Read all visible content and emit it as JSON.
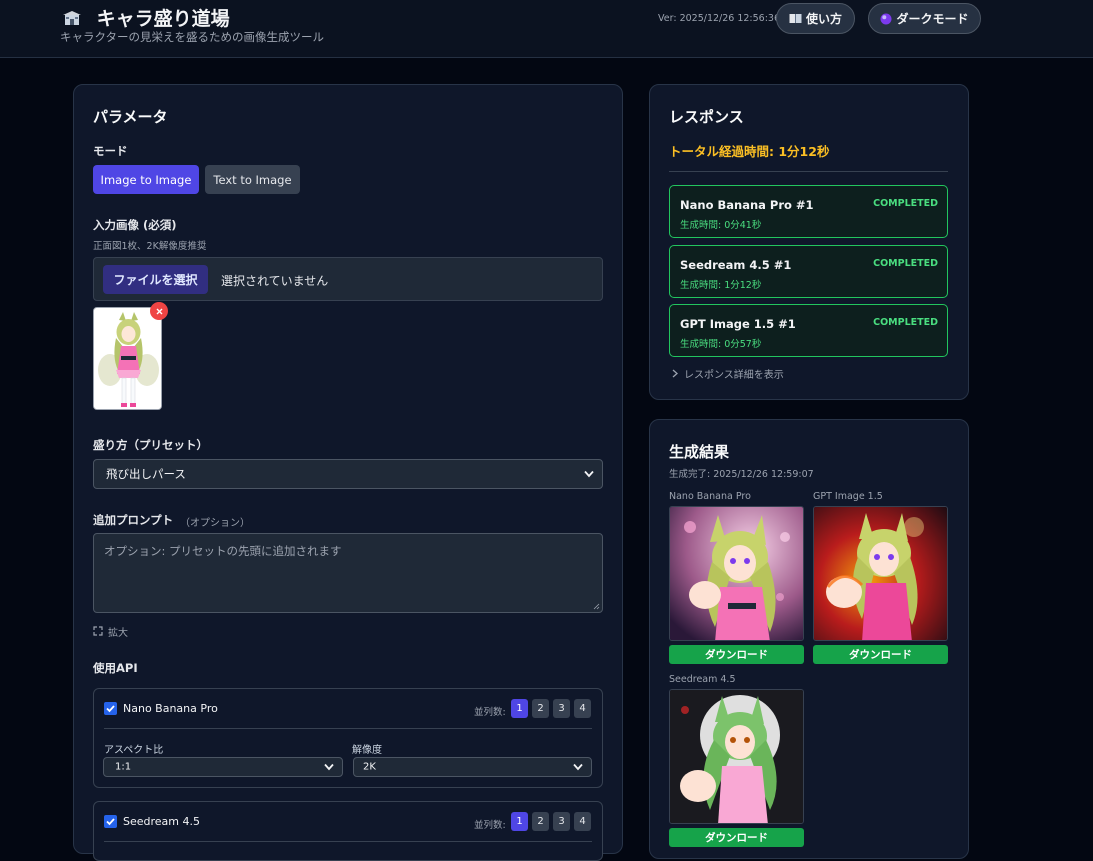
{
  "header": {
    "title": "キャラ盛り道場",
    "subtitle": "キャラクターの見栄えを盛るための画像生成ツール",
    "version": "Ver: 2025/12/26 12:56:36",
    "help_label": "使い方",
    "dark_mode_label": "ダークモード"
  },
  "params": {
    "heading": "パラメータ",
    "mode_label": "モード",
    "modes": [
      "Image to Image",
      "Text to Image"
    ],
    "active_mode": "Image to Image",
    "input_label": "入力画像 (必須)",
    "input_hint": "正面図1枚、2K解像度推奨",
    "file_button": "ファイルを選択",
    "file_status": "選択されていません",
    "preset_label": "盛り方（プリセット）",
    "preset_value": "飛び出しパース",
    "prompt_label": "追加プロンプト",
    "prompt_optional": "（オプション）",
    "prompt_placeholder": "オプション: プリセットの先頭に追加されます",
    "expand_label": "拡大",
    "api_label": "使用API",
    "apis": [
      {
        "name": "Nano Banana Pro",
        "checked": true,
        "parallel_label": "並列数:",
        "parallel_options": [
          "1",
          "2",
          "3",
          "4"
        ],
        "parallel_selected": "1",
        "aspect_label": "アスペクト比",
        "aspect_value": "1:1",
        "resolution_label": "解像度",
        "resolution_value": "2K"
      },
      {
        "name": "Seedream 4.5",
        "checked": true,
        "parallel_label": "並列数:",
        "parallel_options": [
          "1",
          "2",
          "3",
          "4"
        ],
        "parallel_selected": "1"
      }
    ]
  },
  "response": {
    "heading": "レスポンス",
    "total_time": "トータル経過時間: 1分12秒",
    "items": [
      {
        "name": "Nano Banana Pro #1",
        "status": "COMPLETED",
        "time": "生成時間: 0分41秒"
      },
      {
        "name": "Seedream 4.5 #1",
        "status": "COMPLETED",
        "time": "生成時間: 1分12秒"
      },
      {
        "name": "GPT Image 1.5 #1",
        "status": "COMPLETED",
        "time": "生成時間: 0分57秒"
      }
    ],
    "details_toggle": "レスポンス詳細を表示"
  },
  "results": {
    "heading": "生成結果",
    "completed_at": "生成完了: 2025/12/26 12:59:07",
    "images": [
      {
        "label": "Nano Banana Pro",
        "download": "ダウンロード"
      },
      {
        "label": "GPT Image 1.5",
        "download": "ダウンロード"
      },
      {
        "label": "Seedream 4.5",
        "download": "ダウンロード"
      }
    ]
  },
  "colors": {
    "accent": "#4f46e5",
    "success": "#22c55e",
    "warning": "#fbbf24",
    "danger": "#ef4444",
    "download": "#16a34a"
  },
  "icons": {
    "logo": "dojo-building-icon",
    "help": "book-icon",
    "dark_mode": "moon-orb-icon",
    "expand": "expand-arrows-icon",
    "details": "chevron-right-icon"
  }
}
